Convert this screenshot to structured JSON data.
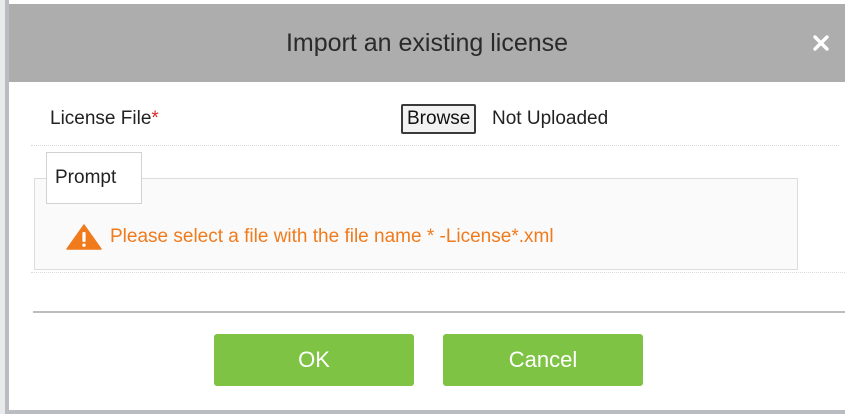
{
  "dialog": {
    "title": "Import an existing license",
    "close_icon": "close-icon"
  },
  "form": {
    "license_label": "License File",
    "required_mark": "*",
    "browse_label": "Browse",
    "upload_status": "Not Uploaded"
  },
  "prompt": {
    "legend": "Prompt",
    "icon": "warning-icon",
    "message": "Please select a file with the file name * -License*.xml"
  },
  "buttons": {
    "ok": "OK",
    "cancel": "Cancel"
  },
  "colors": {
    "title_bar": "#adadad",
    "button_green": "#7ec344",
    "warning_orange": "#f07b1d",
    "required_red": "#e0262d"
  }
}
